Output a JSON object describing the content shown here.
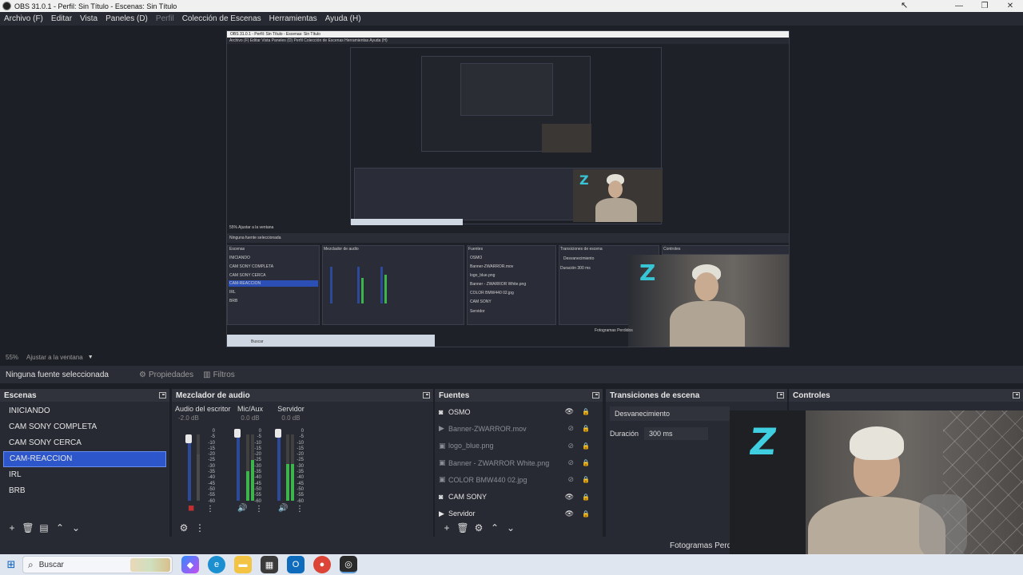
{
  "window": {
    "title": "OBS 31.0.1 - Perfil: Sin Título - Escenas: Sin Título"
  },
  "menu": [
    "Archivo (F)",
    "Editar",
    "Vista",
    "Paneles (D)",
    "Perfil",
    "Colección de Escenas",
    "Herramientas",
    "Ayuda (H)"
  ],
  "scale": {
    "percent": "55%",
    "label": "Ajustar a la ventana"
  },
  "source_bar": {
    "no_selection": "Ninguna fuente seleccionada",
    "properties": "Propiedades",
    "filters": "Filtros"
  },
  "scenes": {
    "title": "Escenas",
    "items": [
      "INICIANDO",
      "CAM SONY COMPLETA",
      "CAM SONY CERCA",
      "CAM-REACCION",
      "IRL",
      "BRB"
    ],
    "selected": "CAM-REACCION"
  },
  "mixer": {
    "title": "Mezclador de audio",
    "channels": [
      {
        "name": "Audio del escritorio",
        "db": "-2.0 dB",
        "level": 0.7
      },
      {
        "name": "Mic/Aux",
        "db": "0.0 dB",
        "level": 0.45
      },
      {
        "name": "Servidor",
        "db": "0.0 dB",
        "level": 0.55
      }
    ],
    "ticks": [
      "0",
      "-5",
      "-10",
      "-15",
      "-20",
      "-25",
      "-30",
      "-35",
      "-40",
      "-45",
      "-50",
      "-55",
      "-60"
    ]
  },
  "sources": {
    "title": "Fuentes",
    "items": [
      {
        "name": "OSMO",
        "icon": "camera-icon",
        "visible": true
      },
      {
        "name": "Banner-ZWARROR.mov",
        "icon": "play-icon",
        "visible": false
      },
      {
        "name": "logo_blue.png",
        "icon": "image-icon",
        "visible": false
      },
      {
        "name": "Banner - ZWARROR White.png",
        "icon": "image-icon",
        "visible": false
      },
      {
        "name": "COLOR BMW440 02.jpg",
        "icon": "image-icon",
        "visible": false
      },
      {
        "name": "CAM SONY",
        "icon": "camera-icon",
        "visible": true
      },
      {
        "name": "Servidor",
        "icon": "play-icon",
        "visible": true
      }
    ]
  },
  "transitions": {
    "title": "Transiciones de escena",
    "selected": "Desvanecimiento",
    "duration_label": "Duración",
    "duration_value": "300 ms"
  },
  "controls": {
    "title": "Controles"
  },
  "status": {
    "frames_label": "Fotogramas Perdidos"
  },
  "taskbar": {
    "search_placeholder": "Buscar"
  },
  "colors": {
    "accent": "#2c56c9",
    "panel": "#272a33",
    "background": "#1d1f26",
    "logo": "#3fcfe0"
  }
}
